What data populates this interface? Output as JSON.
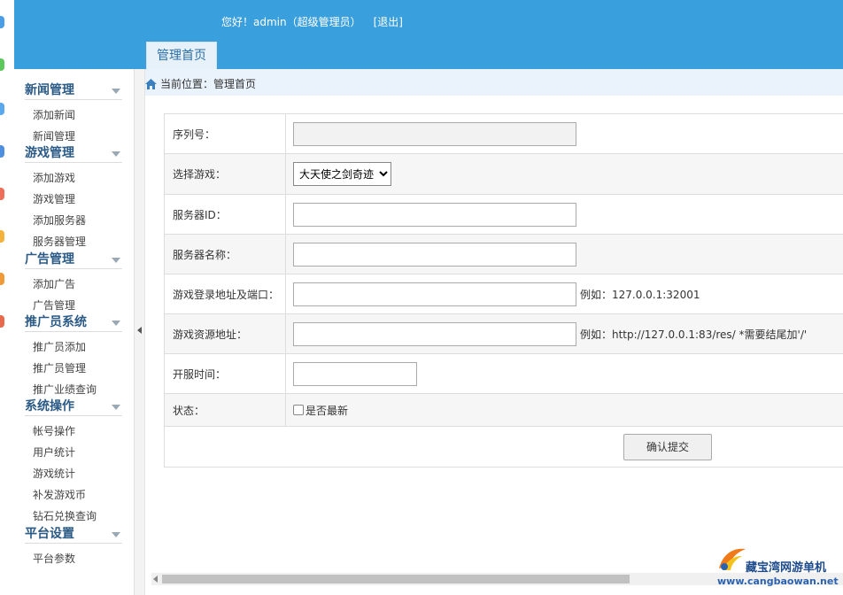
{
  "header": {
    "greeting": "您好！admin（超级管理员）",
    "logout_label": "[退出]",
    "tab_label": "管理首页"
  },
  "breadcrumb": {
    "label": "当前位置：",
    "current": "管理首页"
  },
  "sidebar": {
    "groups": [
      {
        "title": "新闻管理",
        "items": [
          "添加新闻",
          "新闻管理"
        ]
      },
      {
        "title": "游戏管理",
        "items": [
          "添加游戏",
          "游戏管理",
          "添加服务器",
          "服务器管理"
        ]
      },
      {
        "title": "广告管理",
        "items": [
          "添加广告",
          "广告管理"
        ]
      },
      {
        "title": "推广员系统",
        "items": [
          "推广员添加",
          "推广员管理",
          "推广业绩查询"
        ]
      },
      {
        "title": "系统操作",
        "items": [
          "帐号操作",
          "用户统计",
          "游戏统计",
          "补发游戏币",
          "钻石兑换查询"
        ]
      },
      {
        "title": "平台设置",
        "items": [
          "平台参数"
        ]
      }
    ]
  },
  "form": {
    "serial_label": "序列号：",
    "serial_value": "",
    "game_label": "选择游戏：",
    "game_selected": "大天使之剑奇迹",
    "server_id_label": "服务器ID：",
    "server_id_value": "",
    "server_name_label": "服务器名称：",
    "server_name_value": "",
    "login_addr_label": "游戏登录地址及端口：",
    "login_addr_value": "",
    "login_addr_hint": "例如：127.0.0.1:32001",
    "res_addr_label": "游戏资源地址：",
    "res_addr_value": "",
    "res_addr_hint": "例如：http://127.0.0.1:83/res/ *需要结尾加'/'",
    "open_time_label": "开服时间：",
    "open_time_value": "",
    "status_label": "状态：",
    "status_checkbox_label": "是否最新",
    "status_checked": false,
    "submit_label": "确认提交"
  },
  "watermark": {
    "title": "藏宝湾网游单机",
    "url": "www.cangbaowan.net"
  },
  "colors": {
    "header_blue": "#3a9fdd",
    "sidebar_title": "#2a5a85",
    "crumb_bg": "#eaf3fb"
  }
}
